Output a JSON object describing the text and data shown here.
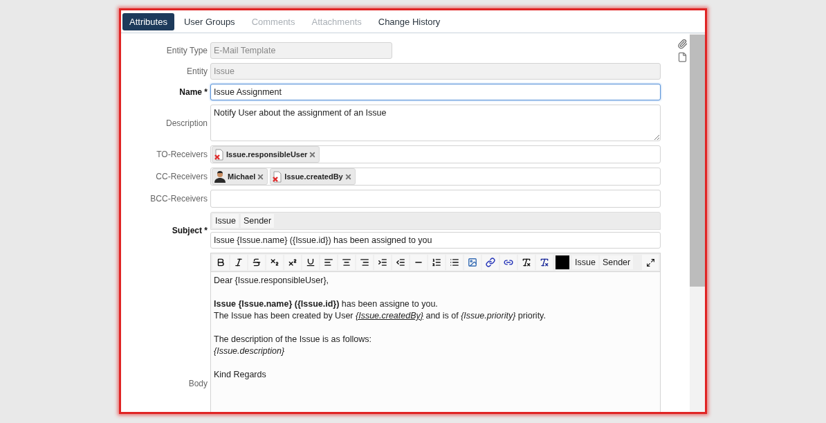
{
  "tabs": [
    {
      "label": "Attributes",
      "selected": true,
      "disabled": false
    },
    {
      "label": "User Groups",
      "selected": false,
      "disabled": false
    },
    {
      "label": "Comments",
      "selected": false,
      "disabled": true
    },
    {
      "label": "Attachments",
      "selected": false,
      "disabled": true
    },
    {
      "label": "Change History",
      "selected": false,
      "disabled": false
    }
  ],
  "fields": [
    {
      "label": "Entity Type",
      "required": false,
      "kind": "select",
      "value": "E-Mail Template",
      "disabled": true,
      "focused": false
    },
    {
      "label": "Entity",
      "required": false,
      "kind": "text",
      "value": "Issue",
      "disabled": true,
      "focused": false
    },
    {
      "label": "Name *",
      "required": true,
      "kind": "text",
      "value": "Issue Assignment",
      "disabled": false,
      "focused": true
    },
    {
      "label": "Description",
      "required": false,
      "kind": "textarea",
      "value": "Notify User about the assignment of an Issue"
    },
    {
      "label": "TO-Receivers",
      "required": false,
      "kind": "chips",
      "chips": [
        {
          "label": "Issue.responsibleUser",
          "kind": "expression"
        }
      ]
    },
    {
      "label": "CC-Receivers",
      "required": false,
      "kind": "chips",
      "chips": [
        {
          "label": "Michael",
          "kind": "person"
        },
        {
          "label": "Issue.createdBy",
          "kind": "expression"
        }
      ]
    },
    {
      "label": "BCC-Receivers",
      "required": false,
      "kind": "chips"
    },
    {
      "label": "Subject *",
      "required": true,
      "kind": "subject",
      "placeholders": [
        "Issue",
        "Sender"
      ],
      "value": "Issue {Issue.name} ({Issue.id}) has been assigned to you"
    },
    {
      "label": "Body",
      "required": false,
      "kind": "editor",
      "placeholders": [
        "Issue",
        "Sender"
      ],
      "paragraphs": [
        [
          [
            {
              "text": "Dear {Issue.responsibleUser},",
              "kind": "plain"
            }
          ]
        ],
        [
          [
            {
              "text": "Issue {Issue.name} ({Issue.id})",
              "kind": "bold"
            },
            {
              "text": " has been assigne to you.",
              "kind": "plain"
            }
          ],
          [
            {
              "text": "The Issue has been created by User ",
              "kind": "plain"
            },
            {
              "text": "{Issue.createdBy}",
              "kind": "underline-italic"
            },
            {
              "text": " and is of ",
              "kind": "plain"
            },
            {
              "text": "{Issue.priority}",
              "kind": "italic"
            },
            {
              "text": " priority.",
              "kind": "plain"
            }
          ]
        ],
        [
          [
            {
              "text": "The description of the Issue is as follows:",
              "kind": "plain"
            }
          ],
          [
            {
              "text": "{Issue.description}",
              "kind": "italic"
            }
          ]
        ],
        [
          [
            {
              "text": "Kind Regards",
              "kind": "plain"
            }
          ]
        ]
      ]
    }
  ]
}
